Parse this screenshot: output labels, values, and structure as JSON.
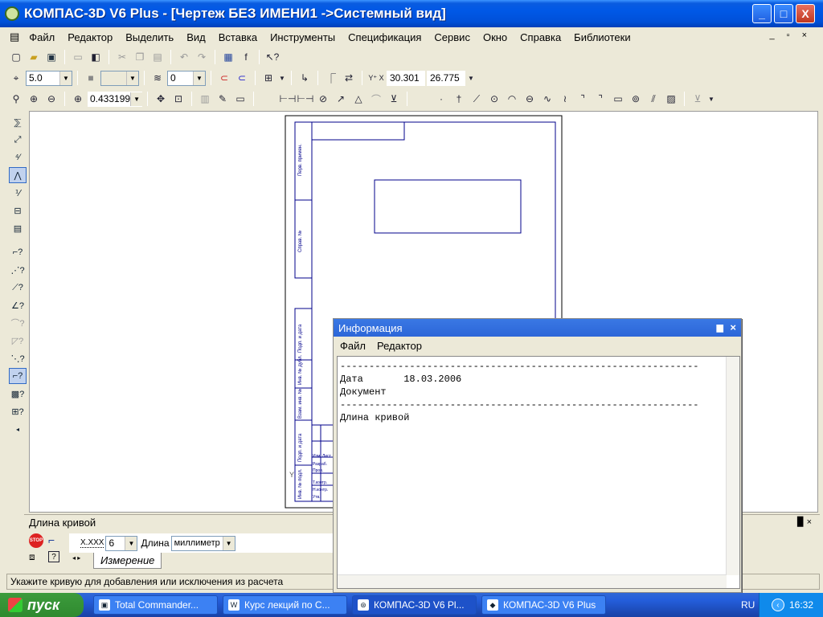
{
  "window": {
    "title": "КОМПАС-3D V6 Plus - [Чертеж БЕЗ ИМЕНИ1 ->Системный вид]",
    "minimize": "_",
    "maximize": "□",
    "close": "X"
  },
  "menu": [
    "Файл",
    "Редактор",
    "Выделить",
    "Вид",
    "Вставка",
    "Инструменты",
    "Спецификация",
    "Сервис",
    "Окно",
    "Справка",
    "Библиотеки"
  ],
  "doc_controls": "_ ▫ ×",
  "toolbar3": {
    "step_value": "5.0",
    "layer_value": "0",
    "x_label": "Y⁺ X",
    "x_coord": "30.301",
    "y_coord": "26.775"
  },
  "toolbar4": {
    "zoom_value": "0.433199"
  },
  "property": {
    "title": "Длина кривой",
    "format_label": "X.XXX",
    "precision": "6",
    "length_label": "Длина",
    "unit": "миллиметр",
    "tab": "Измерение",
    "pin": "▉ ×"
  },
  "status": "Укажите кривую для добавления или исключения из расчета",
  "info": {
    "title": "Информация",
    "pin": "▆",
    "close": "×",
    "menu": [
      "Файл",
      "Редактор"
    ],
    "lines": [
      "--------------------------------------------------------------",
      "Дата       18.03.2006",
      "Документ",
      "--------------------------------------------------------------",
      "Длина кривой"
    ]
  },
  "taskbar": {
    "start": "пуск",
    "tasks": [
      "Total Commander...",
      "Курс лекций по С...",
      "КОМПАС-3D V6 Pl...",
      "КОМПАС-3D V6 Plus"
    ],
    "lang": "RU",
    "time": "16:32"
  },
  "drawing_labels": [
    "Перв. примен.",
    "Справ. №",
    "Подп. и дата",
    "Инв. № дубл.",
    "Взам. инв. №",
    "Подп. и дата",
    "Инв. № подл.",
    "Изм",
    "Лист",
    "Разраб.",
    "Пров.",
    "Т.контр.",
    "Н.контр.",
    "Утв."
  ]
}
